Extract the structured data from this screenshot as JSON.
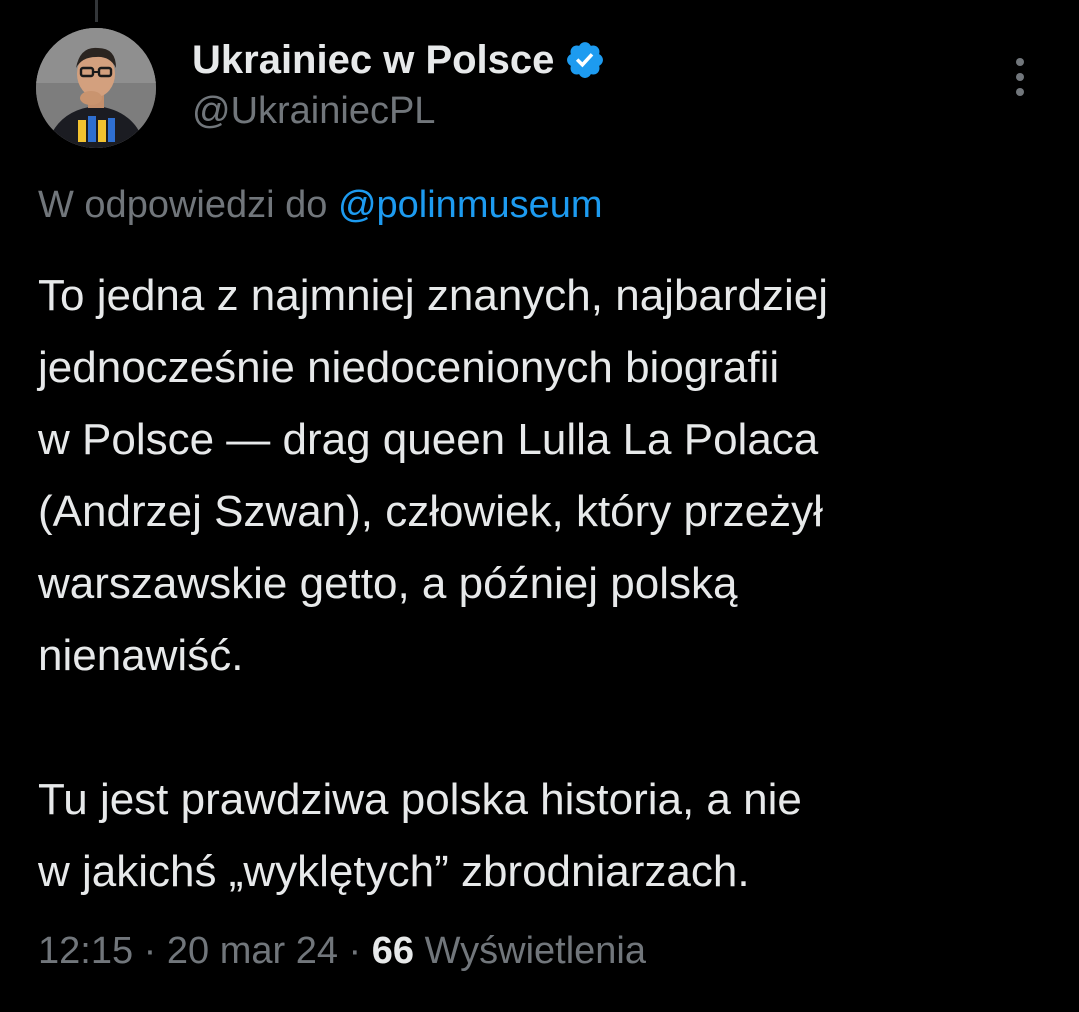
{
  "author": {
    "display_name": "Ukrainiec w Polsce",
    "handle": "@UkrainiecPL",
    "verified": true,
    "avatar_icon": "profile-photo-avatar"
  },
  "reply": {
    "prefix": "W odpowiedzi do",
    "mention": "@polinmuseum"
  },
  "tweet": {
    "paragraphs": [
      "To jedna z najmniej znanych, najbardziej\njednocześnie niedocenionych biografii\nw Polsce — drag queen Lulla La Polaca\n(Andrzej Szwan), człowiek, który przeżył\nwarszawskie getto, a później polską\nnienawiść.",
      "Tu jest prawdziwa polska historia, a nie\nw jakichś „wyklętych” zbrodniarzach."
    ]
  },
  "meta": {
    "time": "12:15",
    "separator": "·",
    "date": "20 mar 24",
    "views_count": "66",
    "views_label": "Wyświetlenia"
  },
  "colors": {
    "background": "#000000",
    "text_primary": "#e7e9ea",
    "text_secondary": "#71767b",
    "link_blue": "#1d9bf0",
    "verified_badge": "#1d9bf0"
  }
}
